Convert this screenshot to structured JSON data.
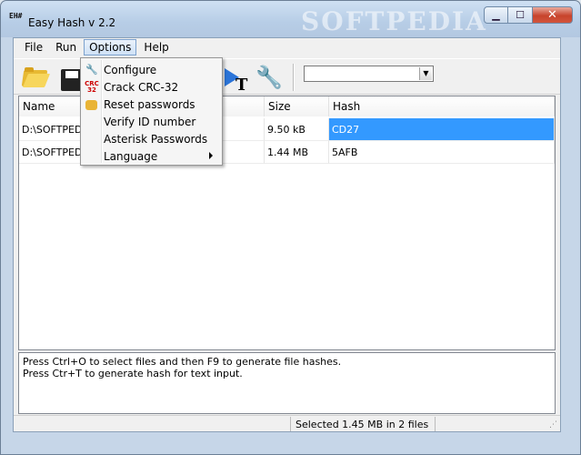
{
  "window": {
    "title": "Easy Hash v 2.2",
    "watermark": "SOFTPEDIA",
    "min_glyph": "▁",
    "max_glyph": "☐",
    "close_glyph": "✕",
    "app_icon_text": "EH#"
  },
  "menubar": {
    "items": [
      "File",
      "Run",
      "Options",
      "Help"
    ]
  },
  "options_menu": {
    "items": [
      {
        "label": "Configure",
        "icon": "wrench-icon"
      },
      {
        "label": "Crack CRC-32",
        "icon": "crc-icon",
        "icon_text": "CRC 32"
      },
      {
        "label": "Reset passwords",
        "icon": "lock-icon"
      },
      {
        "label": "Verify ID number",
        "icon": ""
      },
      {
        "label": "Asterisk Passwords",
        "icon": ""
      },
      {
        "label": "Language",
        "icon": "",
        "submenu": true
      }
    ]
  },
  "toolbar": {
    "hash_select_value": "",
    "arrow_t_glyph": "T",
    "wrench_glyph": "🔧"
  },
  "filelist": {
    "columns": [
      "Name",
      "",
      "Size",
      "Hash"
    ],
    "rows": [
      {
        "name": "D:\\SOFTPEDIA",
        "size": "9.50 kB",
        "hash": "CD27",
        "selected": true
      },
      {
        "name": "D:\\SOFTPEDIA",
        "size": "1.44 MB",
        "hash": "5AFB",
        "selected": false
      }
    ]
  },
  "log": {
    "lines": [
      "Press Ctrl+O to select files and then F9 to generate file hashes.",
      "Press Ctr+T to generate hash for text input."
    ]
  },
  "status": {
    "text": "Selected 1.45 MB in 2 files"
  },
  "colors": {
    "selection": "#3399ff",
    "close_button": "#c7432c"
  }
}
